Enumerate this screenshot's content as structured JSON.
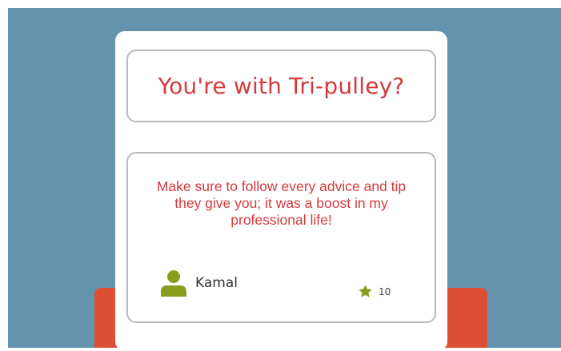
{
  "colors": {
    "backdrop": "#6593ad",
    "accent_text": "#d53a3d",
    "orange_strip": "#dd4f35",
    "icon_green": "#8a9c1b",
    "border": "#b9b9b9"
  },
  "question": {
    "text": "You're with Tri-pulley?"
  },
  "review": {
    "text": "Make sure to follow every advice and tip they give you; it was a boost in my professional life!",
    "reviewer_name": "Kamal",
    "reviewer_icon": "user-icon",
    "rating_icon": "star-icon",
    "rating_count": "10"
  }
}
